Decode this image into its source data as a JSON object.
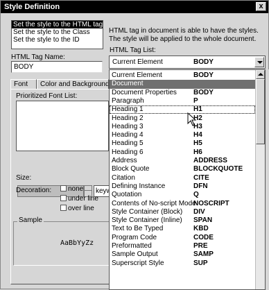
{
  "window": {
    "title": "Style Definition",
    "close_label": "x"
  },
  "style_target": {
    "items": [
      "Set the style to the HTML tag",
      "Set the style to the Class",
      "Set the style to the ID"
    ]
  },
  "description": "HTML tag in document is able to have the styles. The style will be applied to the whole document.",
  "tag_name": {
    "label": "HTML Tag Name:",
    "value": "BODY"
  },
  "tag_list": {
    "label": "HTML Tag List:",
    "selected_name": "Current Element",
    "selected_tag": "BODY",
    "items": [
      {
        "name": "Current Element",
        "tag": "BODY"
      },
      {
        "name": "Document",
        "tag": ""
      },
      {
        "name": "Document Properties",
        "tag": "BODY"
      },
      {
        "name": "Paragraph",
        "tag": "P"
      },
      {
        "name": "Heading 1",
        "tag": "H1"
      },
      {
        "name": "Heading 2",
        "tag": "H2"
      },
      {
        "name": "Heading 3",
        "tag": "H3"
      },
      {
        "name": "Heading 4",
        "tag": "H4"
      },
      {
        "name": "Heading 5",
        "tag": "H5"
      },
      {
        "name": "Heading 6",
        "tag": "H6"
      },
      {
        "name": "Address",
        "tag": "ADDRESS"
      },
      {
        "name": "Block Quote",
        "tag": "BLOCKQUOTE"
      },
      {
        "name": "Citation",
        "tag": "CITE"
      },
      {
        "name": "Defining Instance",
        "tag": "DFN"
      },
      {
        "name": "Quotation",
        "tag": "Q"
      },
      {
        "name": "Contents of No-script Mode",
        "tag": "NOSCRIPT"
      },
      {
        "name": "Style Container (Block)",
        "tag": "DIV"
      },
      {
        "name": "Style Container (Inline)",
        "tag": "SPAN"
      },
      {
        "name": "Text to Be Typed",
        "tag": "KBD"
      },
      {
        "name": "Program Code",
        "tag": "CODE"
      },
      {
        "name": "Preformatted",
        "tag": "PRE"
      },
      {
        "name": "Sample Output",
        "tag": "SAMP"
      },
      {
        "name": "Superscript Style",
        "tag": "SUP"
      }
    ]
  },
  "tabs": [
    "Font",
    "Color and Background"
  ],
  "font_panel": {
    "font_list_label": "Prioritized Font List:",
    "size_label": "Size:",
    "size_unit": "keyw",
    "decoration_label": "Decoration:",
    "decorations": [
      "none",
      "under line",
      "over line"
    ],
    "sample_label": "Sample",
    "sample_text": "AaBbYyZz"
  },
  "colors": {
    "highlight": "#707070",
    "titlebar": "#000000"
  }
}
